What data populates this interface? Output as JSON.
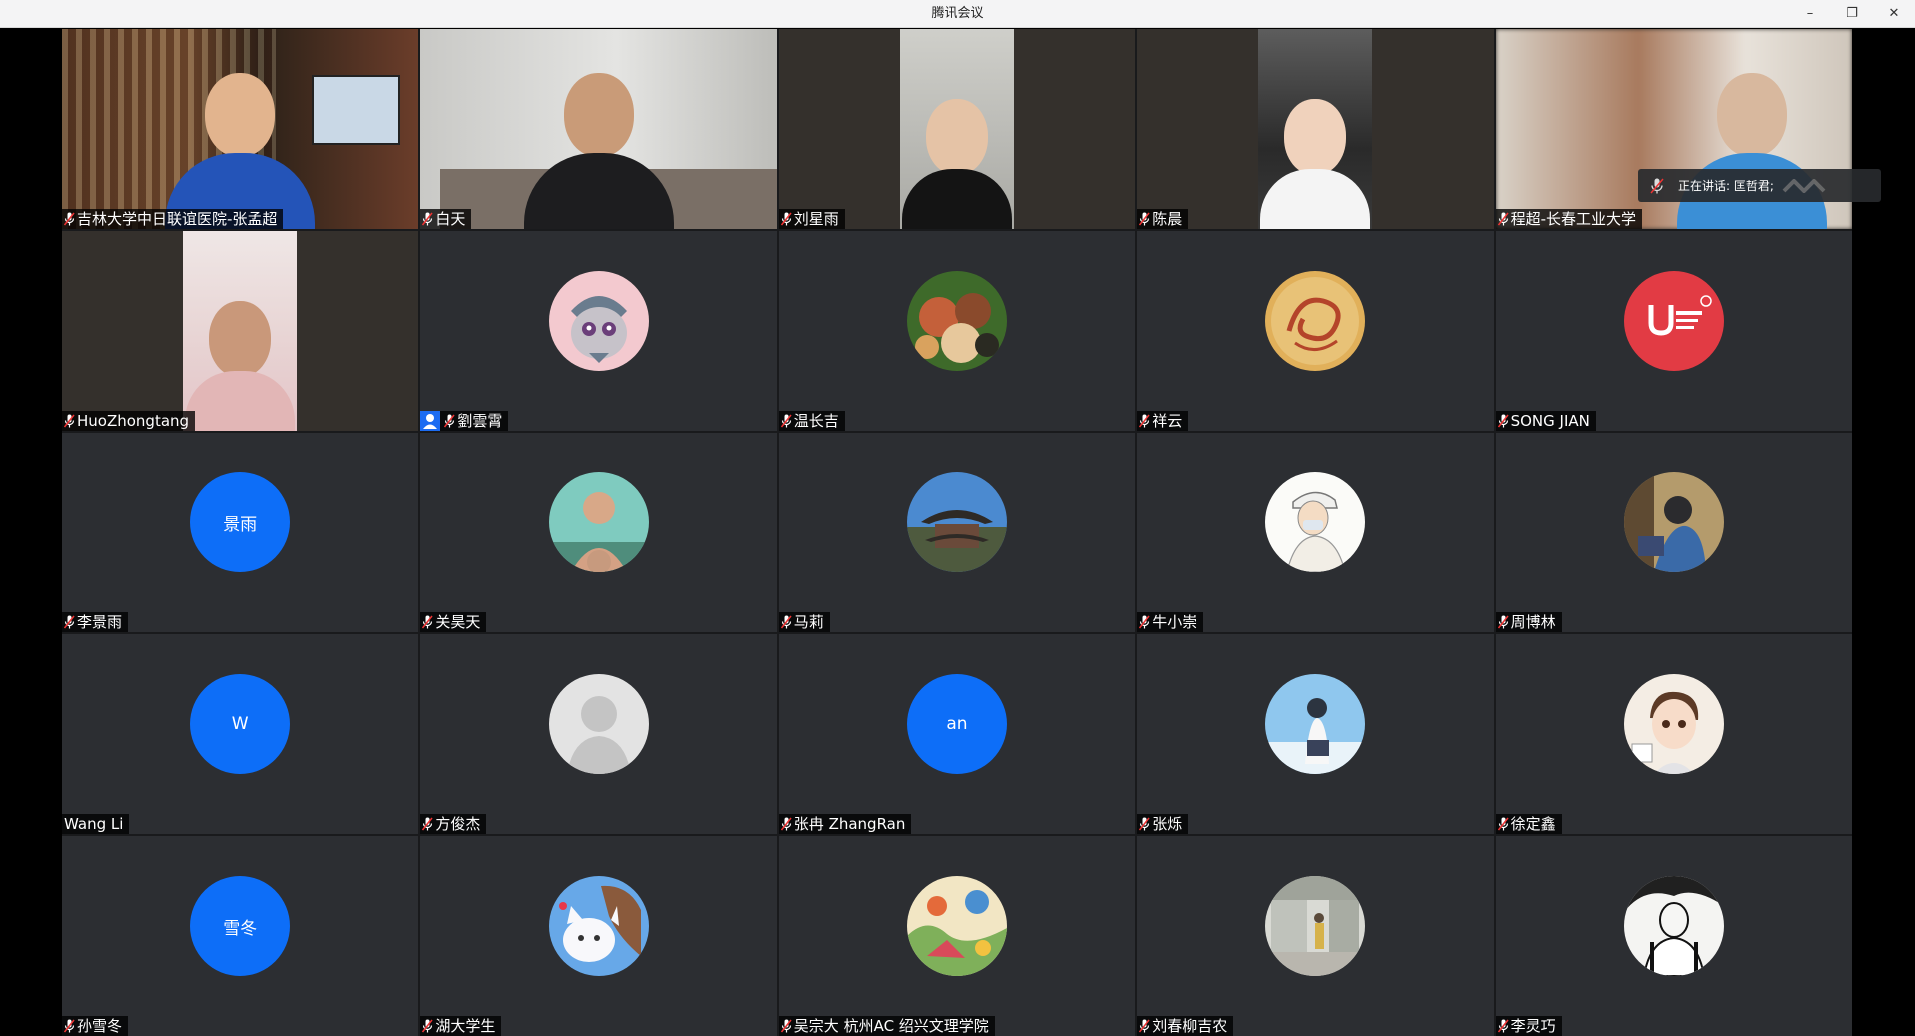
{
  "window": {
    "title": "腾讯会议",
    "minimize": "–",
    "restore": "❐",
    "close": "✕"
  },
  "speaking": {
    "label": "正在讲话: 匡哲君;"
  },
  "participants": [
    {
      "name": "吉林大学中日联谊医院-张孟超",
      "type": "video"
    },
    {
      "name": "白天",
      "type": "video"
    },
    {
      "name": "刘星雨",
      "type": "video"
    },
    {
      "name": "陈晨",
      "type": "video"
    },
    {
      "name": "程超-长春工业大学",
      "type": "video"
    },
    {
      "name": "HuoZhongtang",
      "type": "video"
    },
    {
      "name": "劉雲霄",
      "type": "avatar",
      "avatar": "cartoon-rabbit-icon",
      "host": true
    },
    {
      "name": "温长吉",
      "type": "avatar",
      "avatar": "photo-avatar-icon"
    },
    {
      "name": "祥云",
      "type": "avatar",
      "avatar": "golden-dragon-icon"
    },
    {
      "name": "SONG JIAN",
      "type": "avatar",
      "avatar": "u-logo-icon"
    },
    {
      "name": "李景雨",
      "type": "initials",
      "initials": "景雨"
    },
    {
      "name": "关昊天",
      "type": "avatar",
      "avatar": "photo-avatar-icon"
    },
    {
      "name": "马莉",
      "type": "avatar",
      "avatar": "pavilion-icon"
    },
    {
      "name": "牛小崇",
      "type": "avatar",
      "avatar": "anime-character-icon"
    },
    {
      "name": "周博林",
      "type": "avatar",
      "avatar": "photo-avatar-icon"
    },
    {
      "name": "Wang  Li",
      "type": "initials",
      "initials": "W",
      "nomic": true
    },
    {
      "name": "方俊杰",
      "type": "avatar",
      "avatar": "default-person-icon"
    },
    {
      "name": "张冉 ZhangRan",
      "type": "initials",
      "initials": "an"
    },
    {
      "name": "张烁",
      "type": "avatar",
      "avatar": "anime-character-icon"
    },
    {
      "name": "徐定鑫",
      "type": "avatar",
      "avatar": "anime-character-icon"
    },
    {
      "name": "孙雪冬",
      "type": "initials",
      "initials": "雪冬"
    },
    {
      "name": "湖大学生",
      "type": "avatar",
      "avatar": "cartoon-cat-icon"
    },
    {
      "name": "吴宗大 杭州AC 绍兴文理学院",
      "type": "avatar",
      "avatar": "drawing-avatar-icon"
    },
    {
      "name": "刘春柳吉农",
      "type": "avatar",
      "avatar": "street-photo-icon"
    },
    {
      "name": "李灵巧",
      "type": "avatar",
      "avatar": "sketch-portrait-icon"
    }
  ]
}
